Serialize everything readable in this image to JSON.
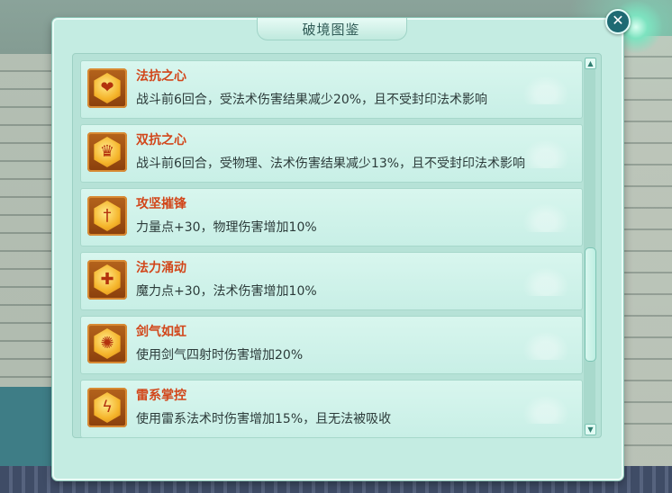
{
  "window": {
    "title": "破境图鉴",
    "close_glyph": "✕"
  },
  "items": [
    {
      "name": "法抗之心",
      "desc": "战斗前6回合，受法术伤害结果减少20%，且不受封印法术影响",
      "icon": "heart-shield-icon",
      "glyph": "❤"
    },
    {
      "name": "双抗之心",
      "desc": "战斗前6回合，受物理、法术伤害结果减少13%，且不受封印法术影响",
      "icon": "double-shield-icon",
      "glyph": "♛"
    },
    {
      "name": "攻坚摧锋",
      "desc": "力量点+30，物理伤害增加10%",
      "icon": "sword-icon",
      "glyph": "†"
    },
    {
      "name": "法力涌动",
      "desc": "魔力点+30，法术伤害增加10%",
      "icon": "magic-burst-icon",
      "glyph": "✚"
    },
    {
      "name": "剑气如虹",
      "desc": "使用剑气四射时伤害增加20%",
      "icon": "sword-aura-icon",
      "glyph": "✺"
    },
    {
      "name": "雷系掌控",
      "desc": "使用雷系法术时伤害增加15%，且无法被吸收",
      "icon": "lightning-icon",
      "glyph": "ϟ"
    }
  ],
  "scrollbar": {
    "up_glyph": "▲",
    "down_glyph": "▼",
    "position": 0.62
  },
  "colors": {
    "panel": "#c4ece2",
    "item_name": "#d2461a",
    "desc_text": "#2c3b3a"
  }
}
